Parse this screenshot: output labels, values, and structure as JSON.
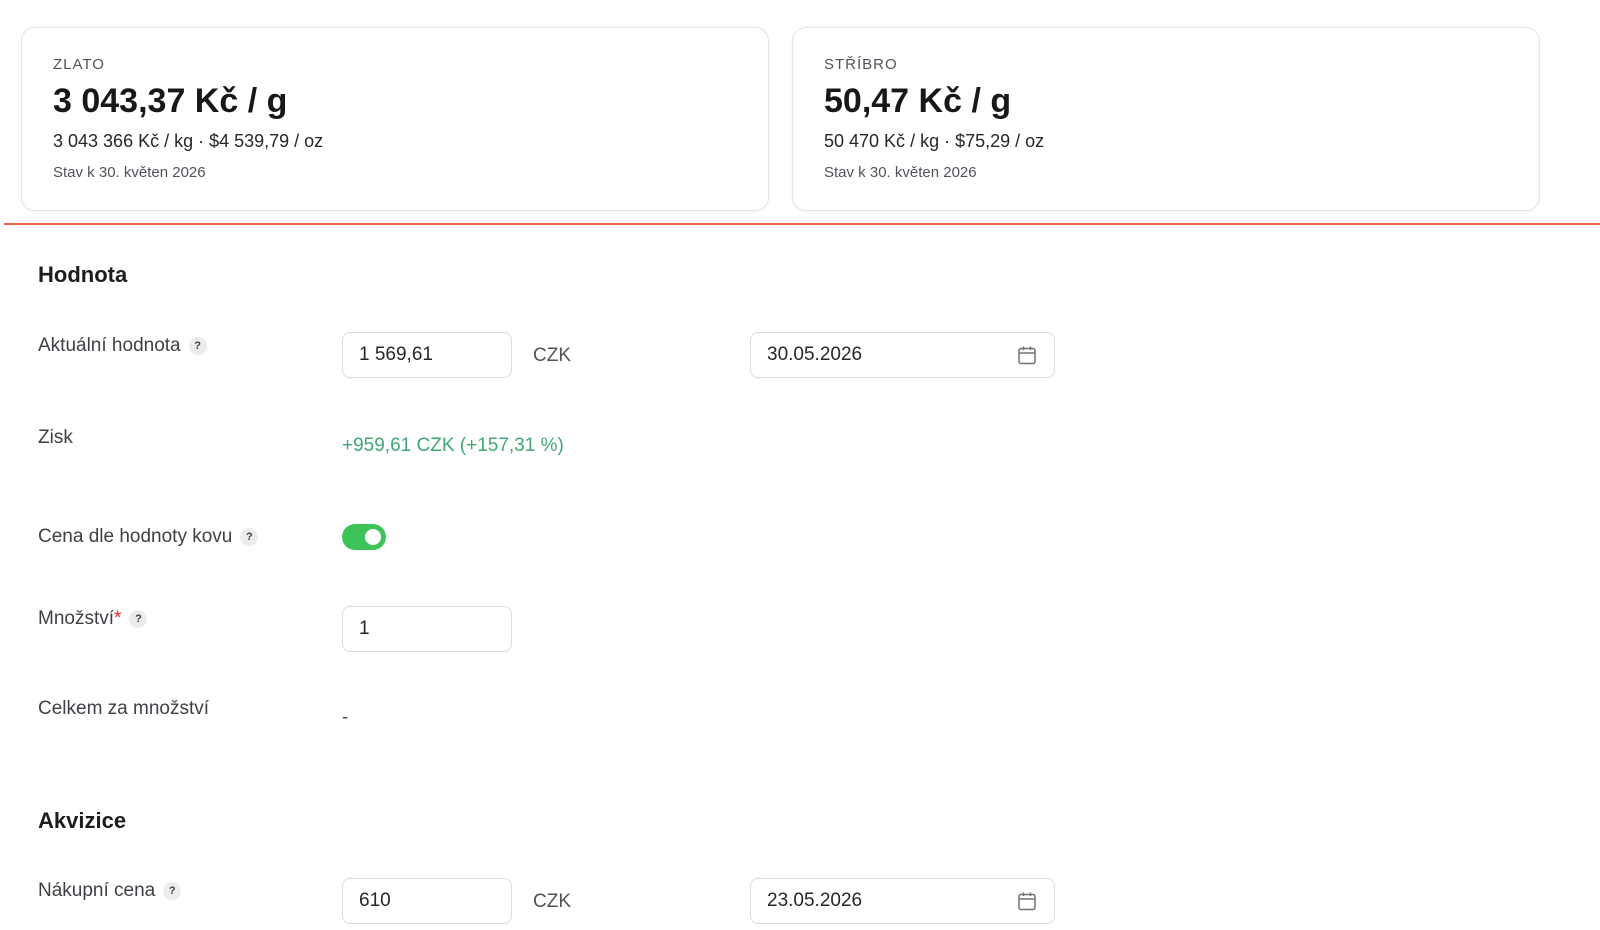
{
  "cards": {
    "gold": {
      "label": "ZLATO",
      "price": "3 043,37 Kč / g",
      "sub": "3 043 366 Kč / kg · $4 539,79 / oz",
      "date": "Stav k 30. květen 2026"
    },
    "silver": {
      "label": "STŘÍBRO",
      "price": "50,47 Kč / g",
      "sub": "50 470 Kč / kg · $75,29 / oz",
      "date": "Stav k 30. květen 2026"
    }
  },
  "value_section": {
    "title": "Hodnota",
    "current_value": {
      "label": "Aktuální hodnota",
      "help": "?",
      "value": "1 569,61",
      "currency": "CZK",
      "date": "30.05.2026"
    },
    "profit": {
      "label": "Zisk",
      "value": "+959,61 CZK (+157,31 %)"
    },
    "metal_price": {
      "label": "Cena dle hodnoty kovu",
      "help": "?",
      "enabled": true
    },
    "quantity": {
      "label": "Množství",
      "required_mark": "*",
      "help": "?",
      "value": "1"
    },
    "total": {
      "label": "Celkem za množství",
      "value": "-"
    }
  },
  "acquisition_section": {
    "title": "Akvizice",
    "purchase_price": {
      "label": "Nákupní cena",
      "help": "?",
      "value": "610",
      "currency": "CZK",
      "date": "23.05.2026"
    }
  },
  "colors": {
    "divider": "#e8624a",
    "gain": "#3fa875",
    "toggle_on": "#3ec35b",
    "required": "#dc2626"
  },
  "icons": {
    "date_picker": "calendar-icon",
    "help": "question-mark-icon"
  }
}
